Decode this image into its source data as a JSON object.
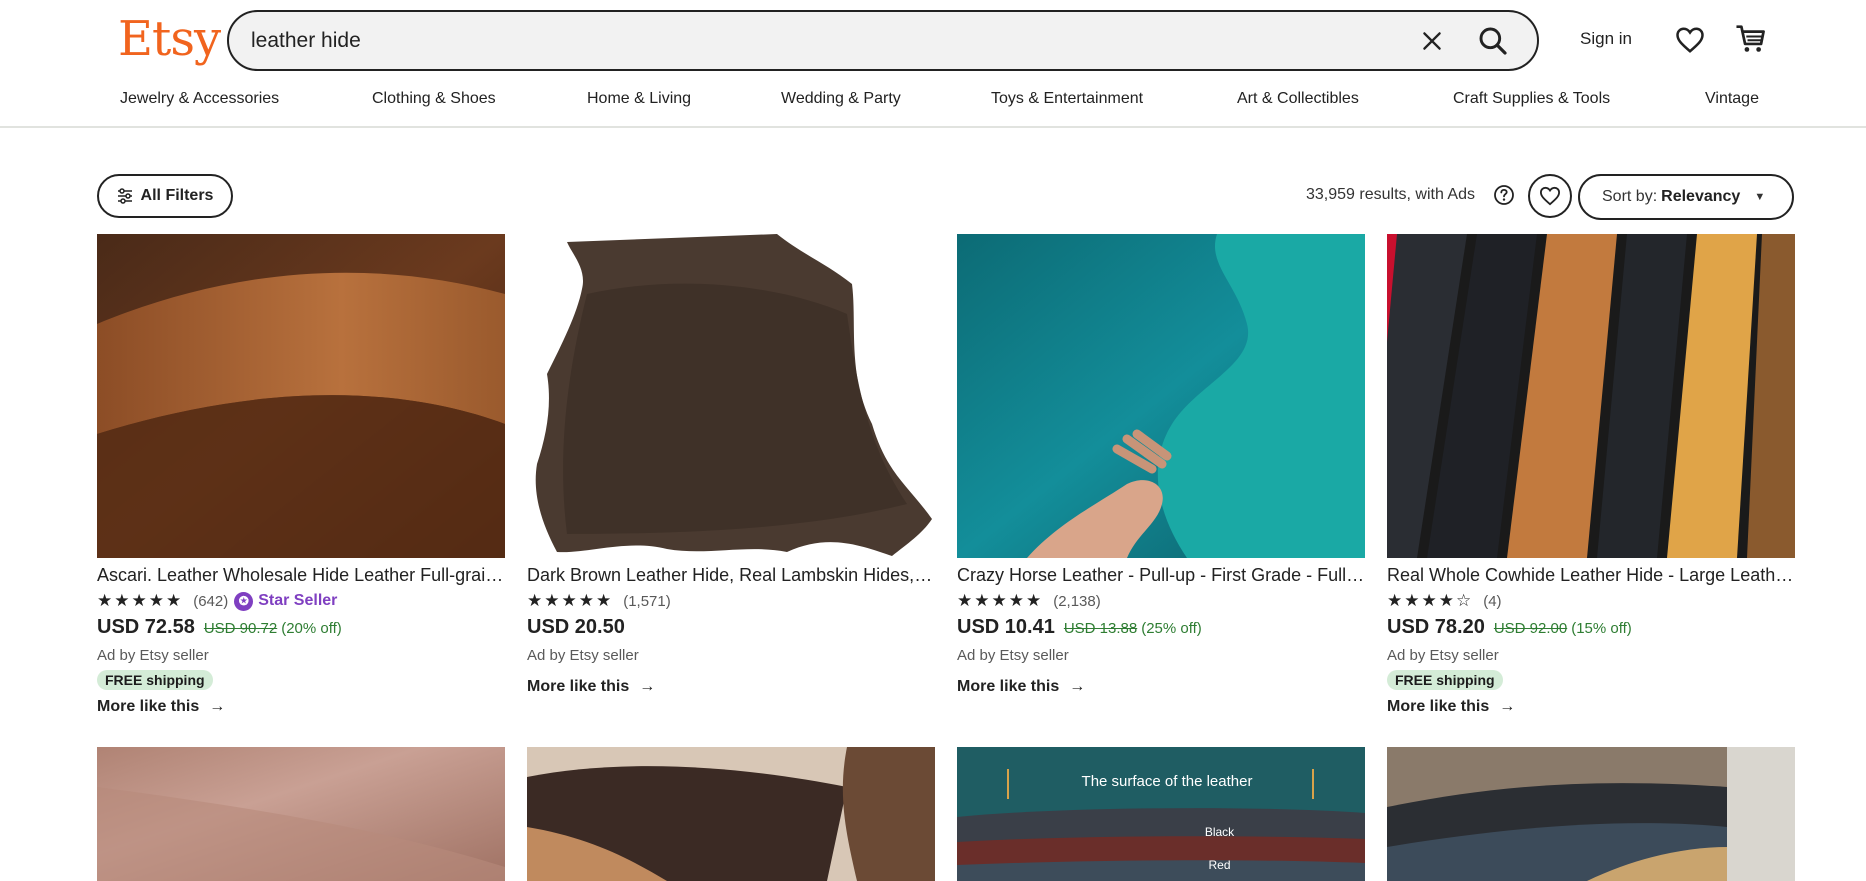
{
  "header": {
    "logo": "Etsy",
    "search_value": "leather hide",
    "sign_in": "Sign in"
  },
  "nav": [
    "Jewelry & Accessories",
    "Clothing & Shoes",
    "Home & Living",
    "Wedding & Party",
    "Toys & Entertainment",
    "Art & Collectibles",
    "Craft Supplies & Tools",
    "Vintage"
  ],
  "toolbar": {
    "filters_label": "All Filters",
    "results_text": "33,959 results, with Ads",
    "sort_prefix": "Sort by:",
    "sort_value": "Relevancy"
  },
  "products": [
    {
      "title": "Ascari. Leather Wholesale Hide Leather Full-grain Cowhide Leather Genuine",
      "stars": "★★★★★",
      "reviews": "(642)",
      "star_seller": "Star Seller",
      "price": "USD 72.58",
      "original_price": "USD 90.72",
      "discount": "(20% off)",
      "ad": "Ad by Etsy seller",
      "shipping": "FREE shipping",
      "more": "More like this"
    },
    {
      "title": "Dark Brown Leather Hide, Real Lambskin Hides, Soft Leather",
      "stars": "★★★★★",
      "reviews": "(1,571)",
      "price": "USD 20.50",
      "ad": "Ad by Etsy seller",
      "more": "More like this"
    },
    {
      "title": "Crazy Horse Leather - Pull-up - First Grade - Full Hide",
      "stars": "★★★★★",
      "reviews": "(2,138)",
      "price": "USD 10.41",
      "original_price": "USD 13.88",
      "discount": "(25% off)",
      "ad": "Ad by Etsy seller",
      "more": "More like this"
    },
    {
      "title": "Real Whole Cowhide Leather Hide - Large Leather Sheets",
      "stars": "★★★★☆",
      "reviews": "(4)",
      "price": "USD 78.20",
      "original_price": "USD 92.00",
      "discount": "(15% off)",
      "ad": "Ad by Etsy seller",
      "shipping": "FREE shipping",
      "more": "More like this"
    }
  ],
  "row2": {
    "card3_caption": "The surface of the leather",
    "card3_label_black": "Black",
    "card3_label_red": "Red"
  },
  "colors": {
    "brand": "#F1641E",
    "star_seller": "#7f3fc1",
    "discount": "#2e7d32",
    "shipping_bg": "#d4ecd7"
  }
}
